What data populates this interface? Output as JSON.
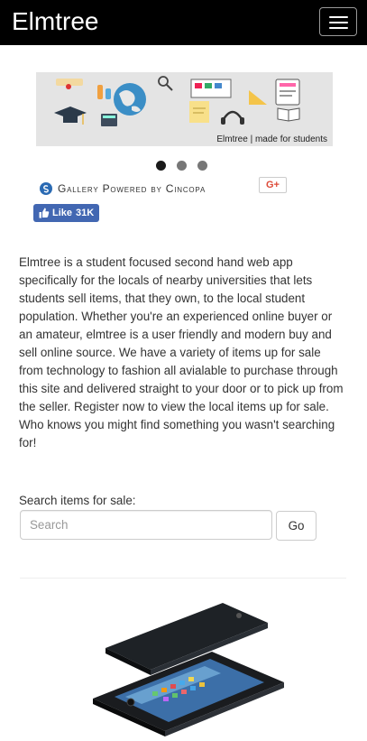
{
  "navbar": {
    "brand": "Elmtree",
    "menu_icon": "hamburger-icon"
  },
  "carousel": {
    "caption": "Elmtree | made for students",
    "slide_count": 3,
    "active_index": 0,
    "colors": {
      "active": "#1a1a1a",
      "inactive": "#777777"
    }
  },
  "gallery": {
    "text": "Gallery Powered by Cincopa",
    "icon": "cincopa-logo-icon"
  },
  "social": {
    "gplus_label": "G+",
    "like_label": "Like",
    "like_count": "31K"
  },
  "about": {
    "text": "Elmtree is a student focused second hand web app specifically for the locals of nearby universities that lets students sell items, that they own, to the local student population. Whether you're an experienced online buyer or an amateur, elmtree is a user friendly and modern buy and sell online source. We have a variety of items up for sale from technology to fashion all avialable to purchase through this site and delivered straight to your door or to pick up from the seller. Register now to view the local items up for sale. Who knows you might find something you wasn't searching for!"
  },
  "search": {
    "label": "Search items for sale:",
    "placeholder": "Search",
    "button_label": "Go"
  },
  "colors": {
    "navbar_bg": "#000000",
    "like_bg": "#4267b2",
    "gplus": "#dd4b39"
  }
}
